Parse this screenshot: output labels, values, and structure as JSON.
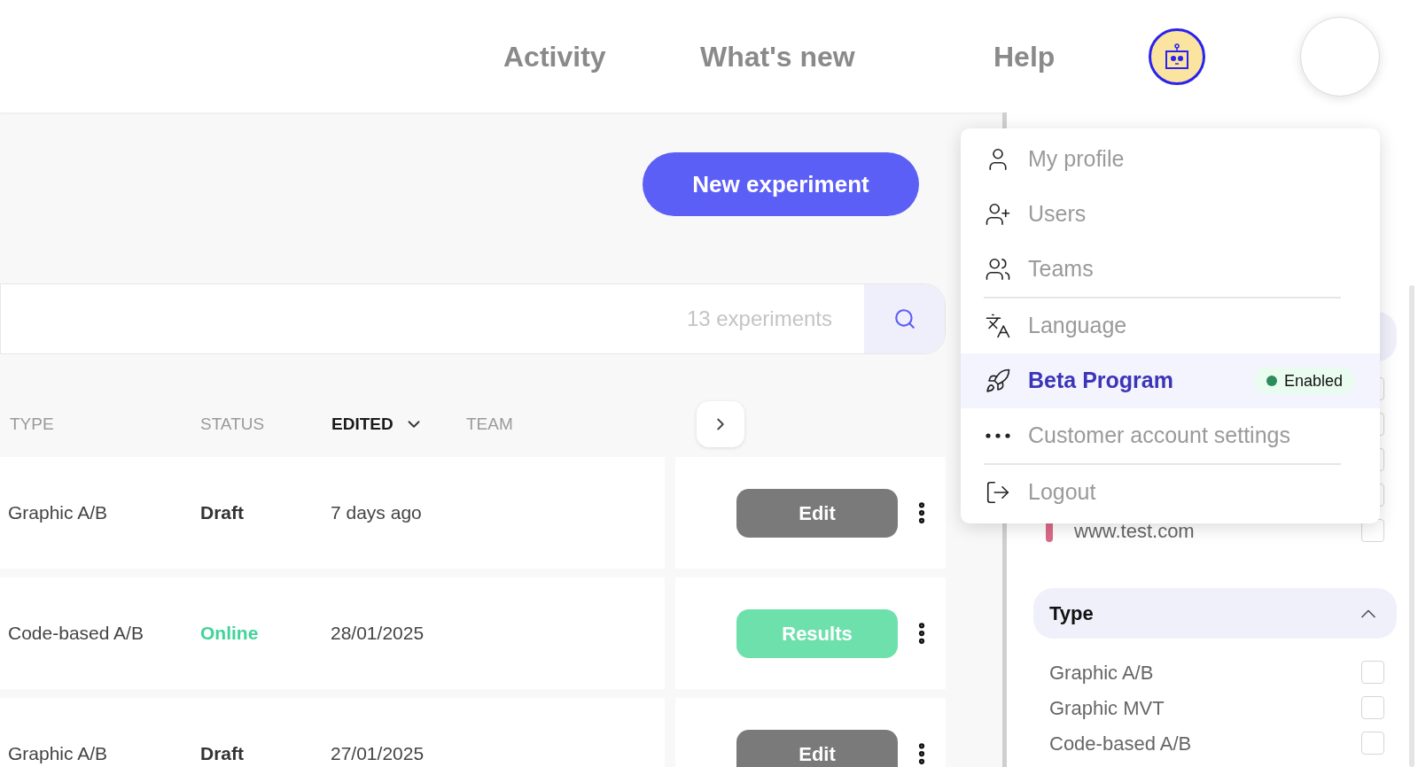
{
  "nav": {
    "items": [
      {
        "label": "Activity"
      },
      {
        "label": "What's new"
      },
      {
        "label": "Help"
      }
    ]
  },
  "toolbar": {
    "new_button": "New experiment",
    "search": {
      "placeholder": "13 experiments"
    }
  },
  "table": {
    "columns": [
      {
        "label": "TYPE",
        "sorted": false
      },
      {
        "label": "STATUS",
        "sorted": false
      },
      {
        "label": "EDITED",
        "sorted": true
      },
      {
        "label": "TEAM",
        "sorted": false
      }
    ],
    "rows": [
      {
        "type": "Graphic A/B",
        "status": "Draft",
        "kind": "draft",
        "edited": "7 days ago",
        "action": "Edit"
      },
      {
        "type": "Code-based A/B",
        "status": "Online",
        "kind": "online",
        "edited": "28/01/2025",
        "action": "Results"
      },
      {
        "type": "Graphic A/B",
        "status": "Draft",
        "kind": "draft",
        "edited": "27/01/2025",
        "action": "Edit"
      }
    ]
  },
  "menu": {
    "items": [
      {
        "label": "My profile",
        "kind": "user",
        "selected": false,
        "divider_after": false
      },
      {
        "label": "Users",
        "kind": "user-plus",
        "selected": false,
        "divider_after": false
      },
      {
        "label": "Teams",
        "kind": "users",
        "selected": false,
        "divider_after": true
      },
      {
        "label": "Language",
        "kind": "language",
        "selected": false,
        "divider_after": false
      },
      {
        "label": "Beta Program",
        "kind": "rocket",
        "selected": true,
        "divider_after": false,
        "badge": {
          "label": "Enabled",
          "color": "#2e8b5e"
        }
      },
      {
        "label": "Customer account settings",
        "kind": "dots",
        "selected": false,
        "divider_after": true
      },
      {
        "label": "Logout",
        "kind": "logout",
        "selected": false,
        "divider_after": false
      }
    ]
  },
  "sidebar": {
    "site_filters": [
      {
        "checked": false
      },
      {
        "checked": false
      },
      {
        "checked": false
      },
      {
        "checked": false
      },
      {
        "label": "www.test.com",
        "color": "#d96a86",
        "checked": false
      }
    ],
    "type_section": {
      "title": "Type",
      "expanded": true,
      "options": [
        {
          "label": "Graphic A/B",
          "checked": false
        },
        {
          "label": "Graphic MVT",
          "checked": false
        },
        {
          "label": "Code-based A/B",
          "checked": false
        }
      ]
    }
  }
}
